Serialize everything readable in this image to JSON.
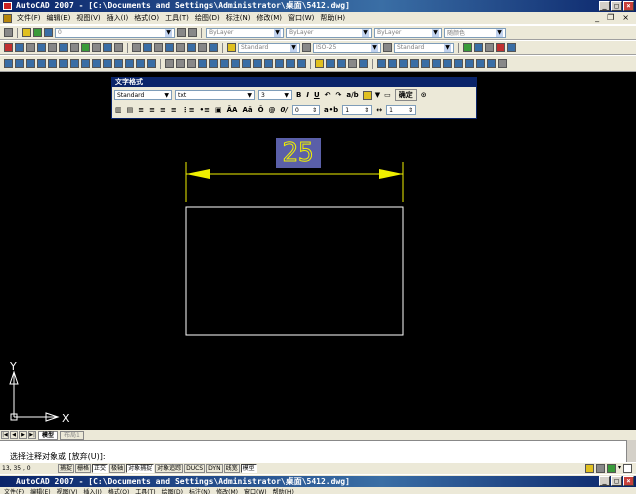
{
  "window": {
    "title": "AutoCAD 2007 - [C:\\Documents and Settings\\Administrator\\桌面\\5412.dwg]"
  },
  "menu": [
    "文件(F)",
    "编辑(E)",
    "视图(V)",
    "插入(I)",
    "格式(O)",
    "工具(T)",
    "绘图(D)",
    "标注(N)",
    "修改(M)",
    "窗口(W)",
    "帮助(H)"
  ],
  "layers": {
    "current": "0",
    "color": "ByLayer",
    "linetype": "ByLayer",
    "lineweight": "ByLayer",
    "plotstyle": "随颜色"
  },
  "styles": {
    "text_style": "Standard",
    "dim_style": "ISO-25",
    "table_style": "Standard"
  },
  "text_format": {
    "title": "文字格式",
    "style": "Standard",
    "font": "txt",
    "height": "3",
    "ok": "确定",
    "oblique": "0",
    "tracking": "1",
    "width": "1"
  },
  "drawing": {
    "dim_text": "25",
    "ucs_y": "Y",
    "ucs_x": "X",
    "accent": "#f0f000",
    "rect_color": "#ffffff",
    "highlight": "#5a5fa8"
  },
  "tabs": {
    "model": "模型",
    "layout": "布局1"
  },
  "command": {
    "prompt": "选择注释对象或 [放弃(U)]:"
  },
  "status": {
    "coords": "13, 35 , 0",
    "buttons": [
      "捕捉",
      "栅格",
      "正交",
      "极轴",
      "对象捕捉",
      "对象追踪",
      "DUCS",
      "DYN",
      "线宽",
      "模型"
    ],
    "active": [
      "正交",
      "对象捕捉",
      "模型"
    ]
  }
}
